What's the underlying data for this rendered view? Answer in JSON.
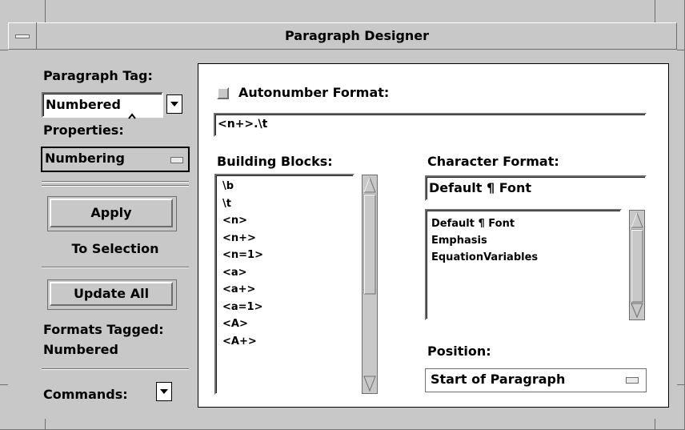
{
  "window": {
    "title": "Paragraph Designer"
  },
  "left": {
    "paragraph_tag_label": "Paragraph Tag:",
    "paragraph_tag_value": "Numbered",
    "properties_label": "Properties:",
    "properties_value": "Numbering",
    "apply_label": "Apply",
    "to_selection_label": "To Selection",
    "update_all_label": "Update All",
    "formats_tagged_label": "Formats Tagged:",
    "formats_tagged_value": "Numbered",
    "commands_label": "Commands:"
  },
  "right": {
    "autonumber_label": "Autonumber Format:",
    "autonumber_checked": false,
    "autonumber_value": "<n+>.\\t",
    "building_blocks_label": "Building Blocks:",
    "building_blocks": [
      "\\b",
      "\\t",
      "<n>",
      "<n+>",
      "<n=1>",
      "<a>",
      "<a+>",
      "<a=1>",
      "<A>",
      "<A+>"
    ],
    "character_format_label": "Character Format:",
    "character_format_value": "Default ¶ Font",
    "character_formats": [
      "Default ¶ Font",
      "Emphasis",
      "EquationVariables"
    ],
    "position_label": "Position:",
    "position_value": "Start of Paragraph"
  },
  "colors": {
    "background": "#c8c8c8",
    "shadow": "#6e6e6e",
    "highlight": "#ffffff"
  }
}
